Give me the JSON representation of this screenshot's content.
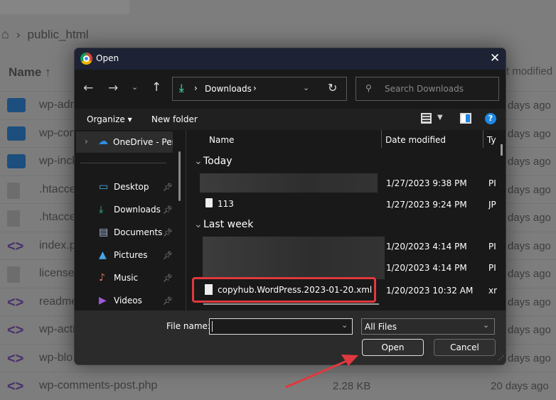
{
  "background": {
    "breadcrumb": "public_html",
    "col_name": "Name",
    "col_modified": "t modified",
    "rows": [
      {
        "name": "wp-adm",
        "icon": "folder-icon",
        "date": "days ago"
      },
      {
        "name": "wp-con",
        "icon": "folder-icon",
        "date": "days ago"
      },
      {
        "name": "wp-incl",
        "icon": "folder-icon",
        "date": "days ago"
      },
      {
        "name": ".htacce",
        "icon": "file-icon",
        "date": "days ago"
      },
      {
        "name": ".htacce",
        "icon": "file-icon",
        "date": "days ago"
      },
      {
        "name": "index.p",
        "icon": "code-icon",
        "date": "days ago"
      },
      {
        "name": "license",
        "icon": "file-icon",
        "date": "days ago"
      },
      {
        "name": "readme",
        "icon": "code-icon",
        "date": "days ago"
      },
      {
        "name": "wp-acti",
        "icon": "code-icon",
        "date": "days ago"
      },
      {
        "name": "wp-blo",
        "icon": "code-icon",
        "date": "days ago"
      },
      {
        "name": "wp-comments-post.php",
        "icon": "code-icon",
        "size": "2.28 KB",
        "date": "20 days ago"
      }
    ]
  },
  "dialog": {
    "title": "Open",
    "address": "Downloads",
    "search_placeholder": "Search Downloads",
    "organize": "Organize",
    "new_folder": "New folder",
    "nav": [
      {
        "label": "OneDrive - Perso",
        "icon": "cloud-icon"
      },
      {
        "label": "Desktop",
        "icon": "desktop-icon"
      },
      {
        "label": "Downloads",
        "icon": "download-icon"
      },
      {
        "label": "Documents",
        "icon": "documents-icon"
      },
      {
        "label": "Pictures",
        "icon": "pictures-icon"
      },
      {
        "label": "Music",
        "icon": "music-icon"
      },
      {
        "label": "Videos",
        "icon": "videos-icon"
      }
    ],
    "columns": {
      "name": "Name",
      "date": "Date modified",
      "type": "Ty"
    },
    "groups": {
      "today": "Today",
      "last_week": "Last week"
    },
    "files": [
      {
        "name": "",
        "date": "1/27/2023 9:38 PM",
        "type": "PI"
      },
      {
        "name": "113",
        "date": "1/27/2023 9:24 PM",
        "type": "JP"
      },
      {
        "name": "",
        "date": "1/20/2023 4:14 PM",
        "type": "PI"
      },
      {
        "name": "",
        "date": "1/20/2023 4:14 PM",
        "type": "PI"
      },
      {
        "name": "copyhub.WordPress.2023-01-20.xml",
        "date": "1/20/2023 10:32 AM",
        "type": "xr"
      }
    ],
    "file_name_label": "File name:",
    "file_name_value": "",
    "file_type": "All Files",
    "open": "Open",
    "cancel": "Cancel"
  },
  "colors": {
    "highlight": "#e0383e",
    "arrow": "#e0383e",
    "accent": "#1e88e5"
  }
}
